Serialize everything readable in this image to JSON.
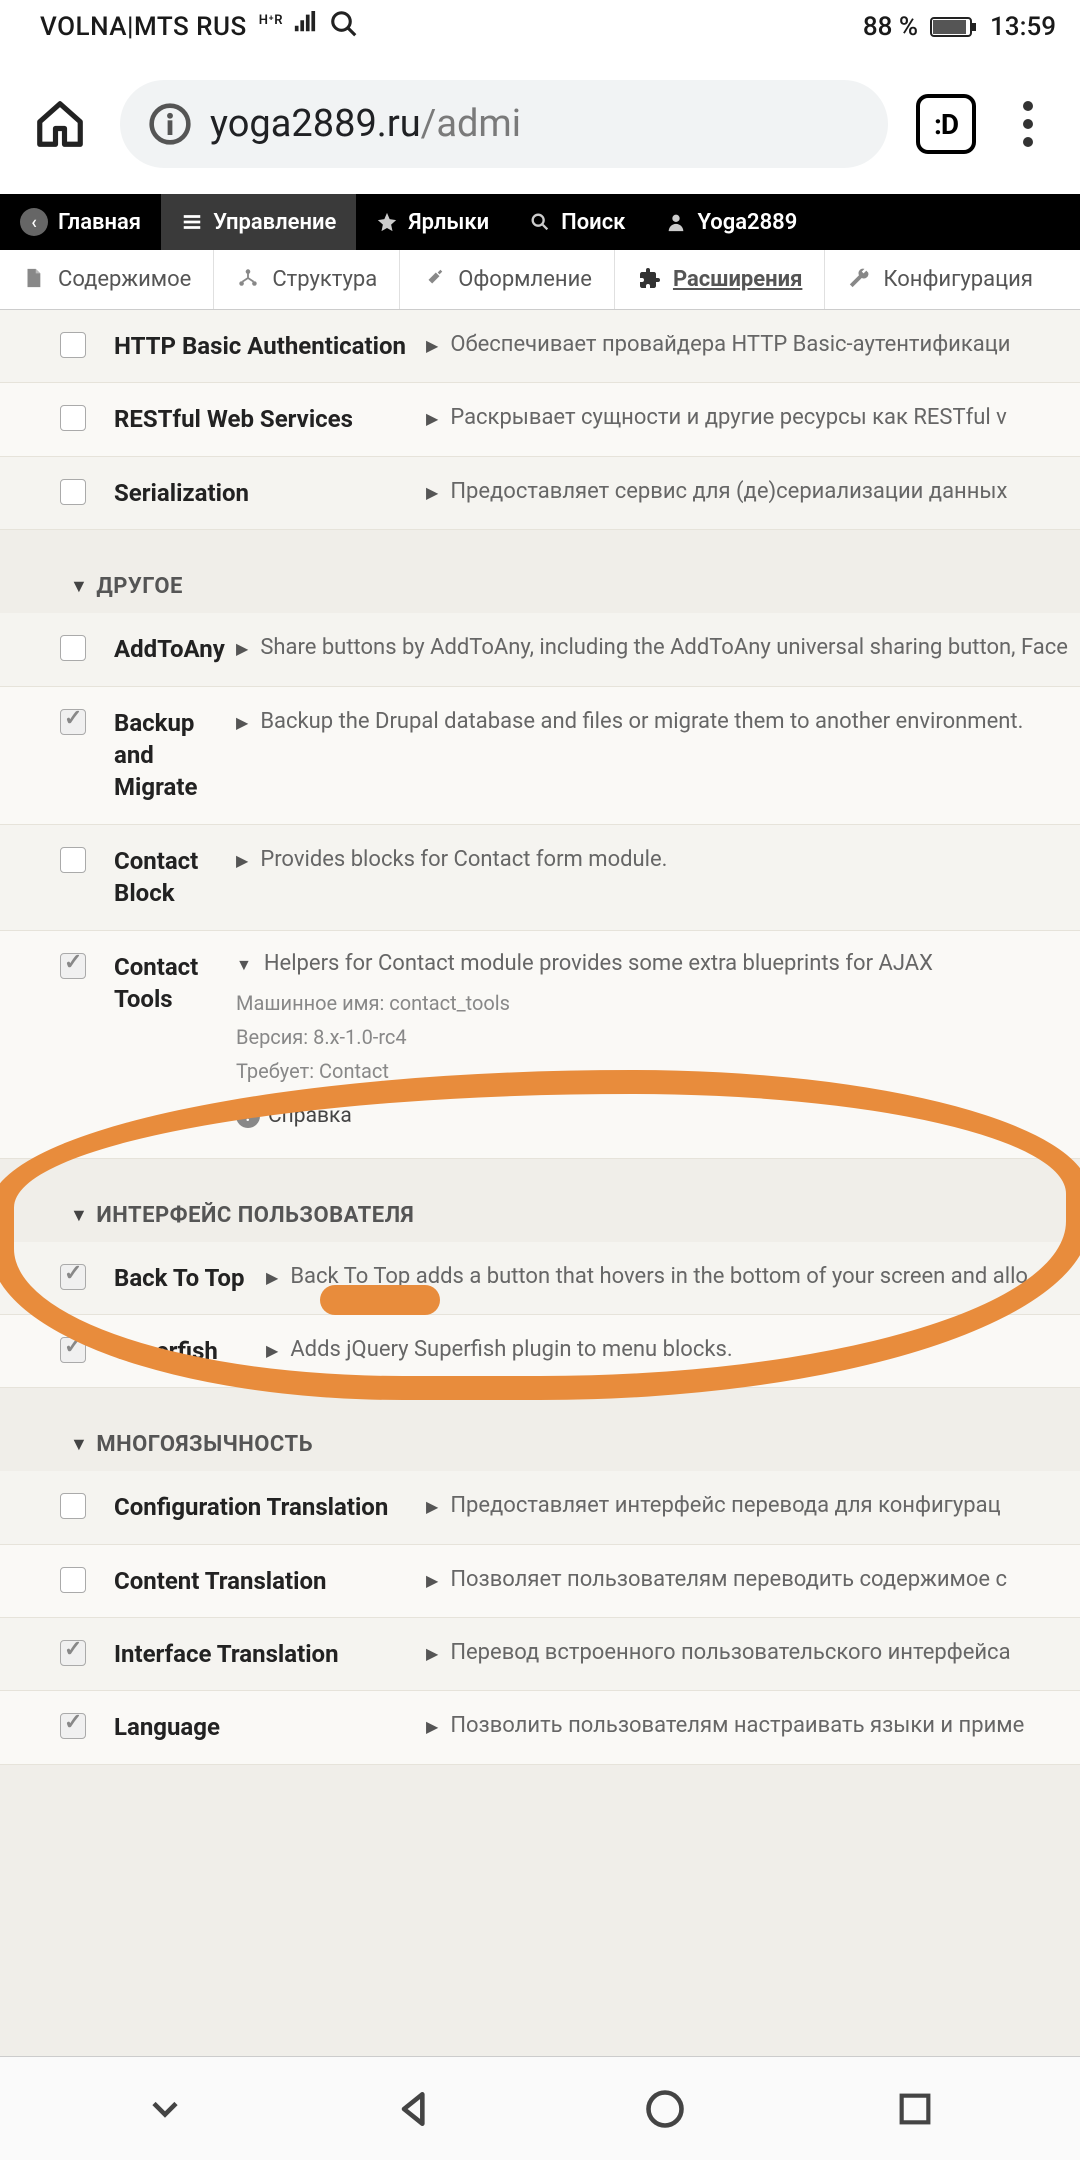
{
  "status": {
    "carrier": "VOLNA|MTS RUS",
    "hr": "H⁺R",
    "battery_pct": "88 %",
    "time": "13:59"
  },
  "browser": {
    "url_main": "yoga2889.ru",
    "url_rest": "/admi",
    "tabs": ":D"
  },
  "admin": {
    "home": "Главная",
    "manage": "Управление",
    "shortcuts": "Ярлыки",
    "search": "Поиск",
    "user": "Yoga2889"
  },
  "tabs": {
    "content": "Содержимое",
    "structure": "Структура",
    "appearance": "Оформление",
    "extend": "Расширения",
    "config": "Конфигурация"
  },
  "sections": {
    "web_services": [
      {
        "checked": false,
        "name": "HTTP Basic Authentication",
        "desc": "Обеспечивает провайдера HTTP Basic-аутентификаци"
      },
      {
        "checked": false,
        "name": "RESTful Web Services",
        "desc": "Раскрывает сущности и другие ресурсы как RESTful v"
      },
      {
        "checked": false,
        "name": "Serialization",
        "desc": "Предоставляет сервис для (де)сериализации данных"
      }
    ],
    "other_header": "ДРУГОЕ",
    "other": [
      {
        "checked": false,
        "name": "AddToAny",
        "desc": "Share buttons by AddToAny, including the AddToAny universal sharing button, Face"
      },
      {
        "checked": true,
        "name": "Backup and Migrate",
        "desc": "Backup the Drupal database and files or migrate them to another environment."
      },
      {
        "checked": false,
        "name": "Contact Block",
        "desc": "Provides blocks for Contact form module."
      }
    ],
    "contact_tools": {
      "name": "Contact Tools",
      "desc": "Helpers for Contact module provides some extra blueprints for AJAX",
      "machine_label": "Машинное имя: ",
      "machine": "contact_tools",
      "version_label": "Версия: ",
      "version": "8.x-1.0-rc4",
      "requires_label": "Требует: ",
      "requires": "Contact",
      "help": "Справка"
    },
    "ui_header": "ИНТЕРФЕЙС ПОЛЬЗОВАТЕЛЯ",
    "ui": [
      {
        "checked": true,
        "name": "Back To Top",
        "desc": "Back To Top adds a button that hovers in the bottom of your screen and allo"
      },
      {
        "checked": true,
        "name": "Superfish",
        "desc": "Adds jQuery Superfish plugin to menu blocks."
      }
    ],
    "ml_header": "МНОГОЯЗЫЧНОСТЬ",
    "ml": [
      {
        "checked": false,
        "name": "Configuration Translation",
        "desc": "Предоставляет интерфейс перевода для конфигурац"
      },
      {
        "checked": false,
        "name": "Content Translation",
        "desc": "Позволяет пользователям переводить содержимое с"
      },
      {
        "checked": true,
        "name": "Interface Translation",
        "desc": "Перевод встроенного пользовательского интерфейса"
      },
      {
        "checked": true,
        "name": "Language",
        "desc": "Позволить пользователям настраивать языки и приме"
      }
    ]
  }
}
